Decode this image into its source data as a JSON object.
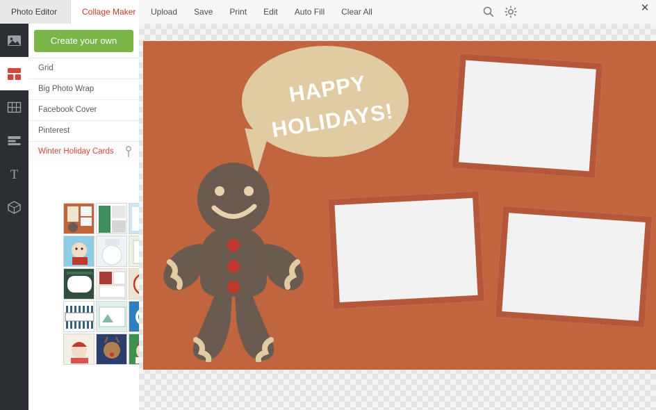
{
  "window": {
    "close_label": "✕"
  },
  "tabs": [
    {
      "label": "Photo Editor",
      "active": false,
      "name": "tab-photo-editor"
    },
    {
      "label": "Collage Maker",
      "active": true,
      "name": "tab-collage-maker"
    }
  ],
  "menu": {
    "items": [
      "Upload",
      "Save",
      "Print",
      "Edit",
      "Auto Fill",
      "Clear All"
    ],
    "icons": [
      "search-icon",
      "gear-icon"
    ]
  },
  "rail": {
    "items": [
      {
        "name": "rail-item-images",
        "icon": "image-icon",
        "selected": false
      },
      {
        "name": "rail-item-layouts",
        "icon": "layout-grid-icon",
        "selected": true
      },
      {
        "name": "rail-item-collage",
        "icon": "grid-cells-icon",
        "selected": false
      },
      {
        "name": "rail-item-frames",
        "icon": "frames-icon",
        "selected": false
      },
      {
        "name": "rail-item-text",
        "icon": "text-t-icon",
        "selected": false
      },
      {
        "name": "rail-item-3d",
        "icon": "cube-icon",
        "selected": false
      }
    ]
  },
  "panel": {
    "create_button": "Create your own",
    "categories": [
      {
        "label": "Grid",
        "selected": false
      },
      {
        "label": "Big Photo Wrap",
        "selected": false
      },
      {
        "label": "Facebook Cover",
        "selected": false
      },
      {
        "label": "Pinterest",
        "selected": false
      },
      {
        "label": "Winter Holiday Cards",
        "selected": true,
        "badge": "pin-icon"
      }
    ],
    "thumbnails": [
      {
        "name": "template-thumb-1",
        "selected": false
      },
      {
        "name": "template-thumb-2",
        "selected": false
      },
      {
        "name": "template-thumb-3",
        "selected": false
      },
      {
        "name": "template-thumb-4",
        "selected": false
      },
      {
        "name": "template-thumb-5",
        "selected": false
      },
      {
        "name": "template-thumb-6",
        "selected": false
      },
      {
        "name": "template-thumb-7",
        "selected": false
      },
      {
        "name": "template-thumb-8",
        "selected": false
      },
      {
        "name": "template-thumb-9",
        "selected": false
      },
      {
        "name": "template-thumb-10",
        "selected": false
      },
      {
        "name": "template-thumb-11",
        "selected": false
      },
      {
        "name": "template-thumb-12",
        "selected": false
      },
      {
        "name": "template-thumb-13",
        "selected": false
      },
      {
        "name": "template-thumb-14",
        "selected": false
      },
      {
        "name": "template-thumb-15",
        "selected": false
      }
    ]
  },
  "canvas": {
    "background_color": "#c1653f",
    "speech_bubble": {
      "line1": "HAPPY",
      "line2": "HOLIDAYS!",
      "color": "#e0cba2",
      "text_color": "#ffffff"
    },
    "gingerbread": {
      "body_color": "#6b5a4f",
      "icing_color": "#e0cba2",
      "button_color": "#c0392b"
    },
    "photo_slots": [
      {
        "name": "photo-slot-top-right"
      },
      {
        "name": "photo-slot-bottom-left"
      },
      {
        "name": "photo-slot-bottom-right"
      }
    ]
  }
}
